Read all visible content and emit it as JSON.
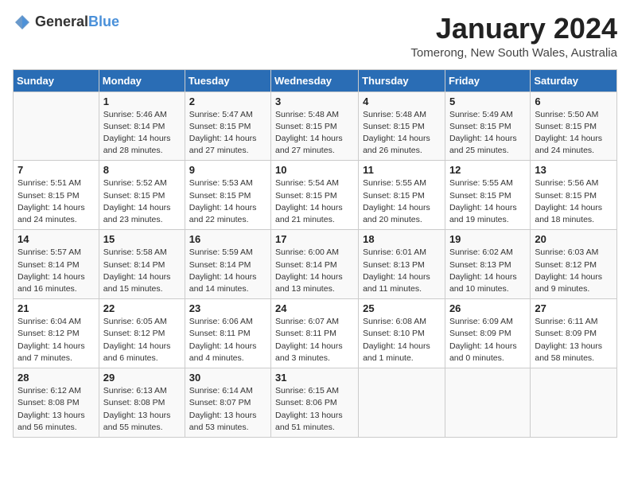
{
  "header": {
    "logo_general": "General",
    "logo_blue": "Blue",
    "month_title": "January 2024",
    "subtitle": "Tomerong, New South Wales, Australia"
  },
  "days_of_week": [
    "Sunday",
    "Monday",
    "Tuesday",
    "Wednesday",
    "Thursday",
    "Friday",
    "Saturday"
  ],
  "weeks": [
    [
      {
        "day": "",
        "content": ""
      },
      {
        "day": "1",
        "content": "Sunrise: 5:46 AM\nSunset: 8:14 PM\nDaylight: 14 hours\nand 28 minutes."
      },
      {
        "day": "2",
        "content": "Sunrise: 5:47 AM\nSunset: 8:15 PM\nDaylight: 14 hours\nand 27 minutes."
      },
      {
        "day": "3",
        "content": "Sunrise: 5:48 AM\nSunset: 8:15 PM\nDaylight: 14 hours\nand 27 minutes."
      },
      {
        "day": "4",
        "content": "Sunrise: 5:48 AM\nSunset: 8:15 PM\nDaylight: 14 hours\nand 26 minutes."
      },
      {
        "day": "5",
        "content": "Sunrise: 5:49 AM\nSunset: 8:15 PM\nDaylight: 14 hours\nand 25 minutes."
      },
      {
        "day": "6",
        "content": "Sunrise: 5:50 AM\nSunset: 8:15 PM\nDaylight: 14 hours\nand 24 minutes."
      }
    ],
    [
      {
        "day": "7",
        "content": "Sunrise: 5:51 AM\nSunset: 8:15 PM\nDaylight: 14 hours\nand 24 minutes."
      },
      {
        "day": "8",
        "content": "Sunrise: 5:52 AM\nSunset: 8:15 PM\nDaylight: 14 hours\nand 23 minutes."
      },
      {
        "day": "9",
        "content": "Sunrise: 5:53 AM\nSunset: 8:15 PM\nDaylight: 14 hours\nand 22 minutes."
      },
      {
        "day": "10",
        "content": "Sunrise: 5:54 AM\nSunset: 8:15 PM\nDaylight: 14 hours\nand 21 minutes."
      },
      {
        "day": "11",
        "content": "Sunrise: 5:55 AM\nSunset: 8:15 PM\nDaylight: 14 hours\nand 20 minutes."
      },
      {
        "day": "12",
        "content": "Sunrise: 5:55 AM\nSunset: 8:15 PM\nDaylight: 14 hours\nand 19 minutes."
      },
      {
        "day": "13",
        "content": "Sunrise: 5:56 AM\nSunset: 8:15 PM\nDaylight: 14 hours\nand 18 minutes."
      }
    ],
    [
      {
        "day": "14",
        "content": "Sunrise: 5:57 AM\nSunset: 8:14 PM\nDaylight: 14 hours\nand 16 minutes."
      },
      {
        "day": "15",
        "content": "Sunrise: 5:58 AM\nSunset: 8:14 PM\nDaylight: 14 hours\nand 15 minutes."
      },
      {
        "day": "16",
        "content": "Sunrise: 5:59 AM\nSunset: 8:14 PM\nDaylight: 14 hours\nand 14 minutes."
      },
      {
        "day": "17",
        "content": "Sunrise: 6:00 AM\nSunset: 8:14 PM\nDaylight: 14 hours\nand 13 minutes."
      },
      {
        "day": "18",
        "content": "Sunrise: 6:01 AM\nSunset: 8:13 PM\nDaylight: 14 hours\nand 11 minutes."
      },
      {
        "day": "19",
        "content": "Sunrise: 6:02 AM\nSunset: 8:13 PM\nDaylight: 14 hours\nand 10 minutes."
      },
      {
        "day": "20",
        "content": "Sunrise: 6:03 AM\nSunset: 8:12 PM\nDaylight: 14 hours\nand 9 minutes."
      }
    ],
    [
      {
        "day": "21",
        "content": "Sunrise: 6:04 AM\nSunset: 8:12 PM\nDaylight: 14 hours\nand 7 minutes."
      },
      {
        "day": "22",
        "content": "Sunrise: 6:05 AM\nSunset: 8:12 PM\nDaylight: 14 hours\nand 6 minutes."
      },
      {
        "day": "23",
        "content": "Sunrise: 6:06 AM\nSunset: 8:11 PM\nDaylight: 14 hours\nand 4 minutes."
      },
      {
        "day": "24",
        "content": "Sunrise: 6:07 AM\nSunset: 8:11 PM\nDaylight: 14 hours\nand 3 minutes."
      },
      {
        "day": "25",
        "content": "Sunrise: 6:08 AM\nSunset: 8:10 PM\nDaylight: 14 hours\nand 1 minute."
      },
      {
        "day": "26",
        "content": "Sunrise: 6:09 AM\nSunset: 8:09 PM\nDaylight: 14 hours\nand 0 minutes."
      },
      {
        "day": "27",
        "content": "Sunrise: 6:11 AM\nSunset: 8:09 PM\nDaylight: 13 hours\nand 58 minutes."
      }
    ],
    [
      {
        "day": "28",
        "content": "Sunrise: 6:12 AM\nSunset: 8:08 PM\nDaylight: 13 hours\nand 56 minutes."
      },
      {
        "day": "29",
        "content": "Sunrise: 6:13 AM\nSunset: 8:08 PM\nDaylight: 13 hours\nand 55 minutes."
      },
      {
        "day": "30",
        "content": "Sunrise: 6:14 AM\nSunset: 8:07 PM\nDaylight: 13 hours\nand 53 minutes."
      },
      {
        "day": "31",
        "content": "Sunrise: 6:15 AM\nSunset: 8:06 PM\nDaylight: 13 hours\nand 51 minutes."
      },
      {
        "day": "",
        "content": ""
      },
      {
        "day": "",
        "content": ""
      },
      {
        "day": "",
        "content": ""
      }
    ]
  ]
}
